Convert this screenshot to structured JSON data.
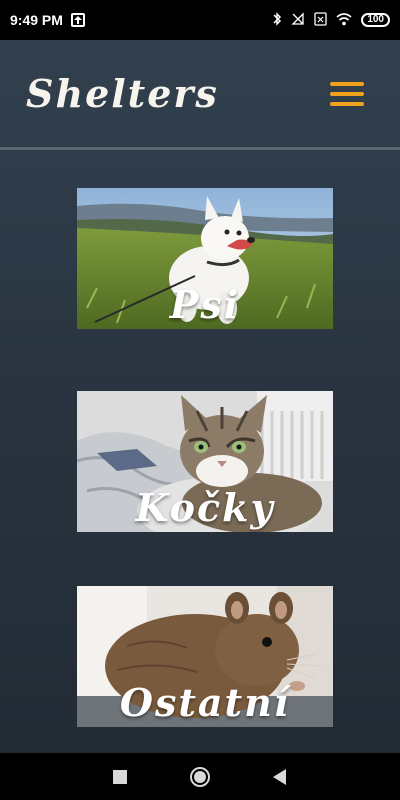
{
  "status_bar": {
    "time": "9:49 PM",
    "battery": "100",
    "icons": [
      "upload-icon",
      "bluetooth-icon",
      "no-signal-icon",
      "sim-icon",
      "wifi-icon",
      "battery-icon"
    ]
  },
  "header": {
    "title": "Shelters",
    "menu_icon": "hamburger-menu-icon",
    "accent_color": "#f0a21d"
  },
  "categories": [
    {
      "label": "Psi",
      "image": "white dog on grassy hill"
    },
    {
      "label": "Kočky",
      "image": "tabby cat on bed"
    },
    {
      "label": "Ostatní",
      "image": "degu rodent"
    }
  ],
  "nav_bar": {
    "icons": [
      "recent-apps-icon",
      "home-icon",
      "back-icon"
    ]
  }
}
